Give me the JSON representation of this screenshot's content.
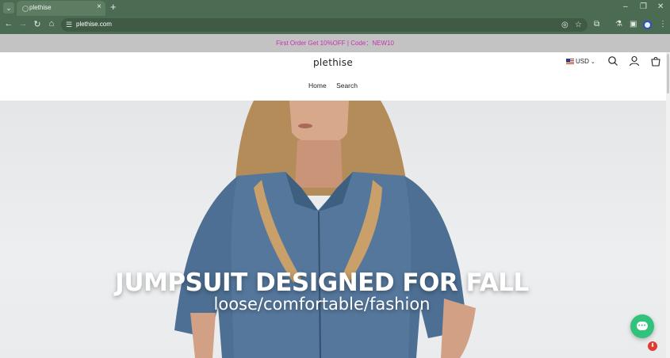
{
  "browser": {
    "tab_title": "plethise",
    "url": "plethise.com",
    "tab_list_icon": "chevron-down-icon",
    "new_tab_icon": "plus-icon",
    "window_controls": [
      "minimize-icon",
      "restore-icon",
      "close-icon"
    ]
  },
  "announcement": {
    "text": "First Order Get 10%OFF | Code：NEW10",
    "color": "#cc2fb7"
  },
  "header": {
    "logo": "plethise",
    "currency": "USD",
    "nav": [
      "Home",
      "Search"
    ]
  },
  "hero": {
    "title": "JUMPSUIT DESIGNED FOR FALL",
    "subtitle": "loose/comfortable/fashion"
  },
  "chat": {
    "icon": "chat-bubble-icon",
    "accent": "#31c27c"
  },
  "colors": {
    "chrome": "#4b6b52",
    "announce_bg": "#c3c3c3"
  }
}
